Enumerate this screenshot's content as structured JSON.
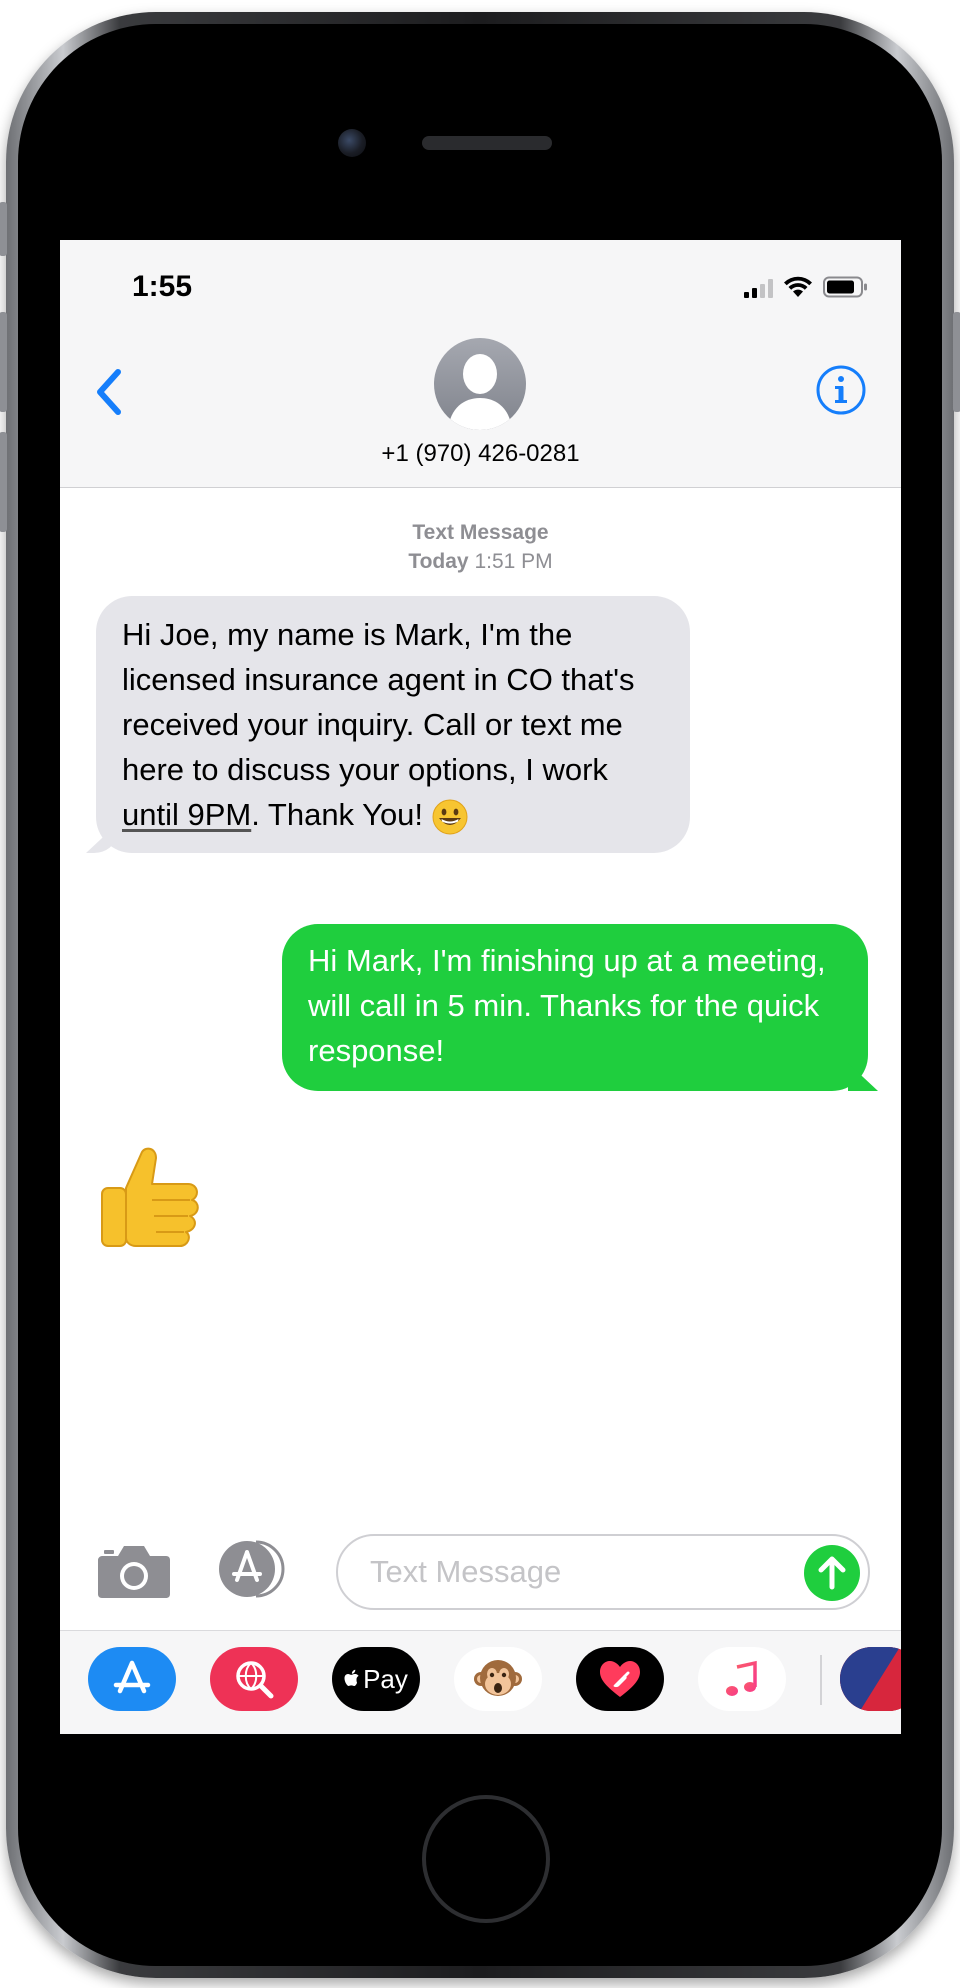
{
  "status_bar": {
    "time": "1:55",
    "icons": [
      "cellular-signal-icon",
      "wifi-icon",
      "battery-icon"
    ]
  },
  "header": {
    "back_icon": "chevron-left-icon",
    "avatar_icon": "person-silhouette-icon",
    "contact_number": "+1 (970) 426-0281",
    "info_icon": "info-icon"
  },
  "conversation": {
    "meta_title": "Text Message",
    "meta_day": "Today",
    "meta_time": "1:51 PM",
    "incoming": {
      "text_before_link": "Hi Joe, my name is Mark, I'm the licensed insurance agent in CO that's received your inquiry. Call or text me here to discuss your options, I work ",
      "link_text": "until 9PM",
      "text_after_link": ". Thank You!",
      "emoji": "grinning-face-emoji"
    },
    "outgoing": {
      "text": "Hi Mark, I'm finishing up at a meeting, will call in 5 min. Thanks for the quick response!"
    },
    "reaction_emoji": "thumbs-up-emoji"
  },
  "composer": {
    "camera_icon": "camera-icon",
    "apps_icon": "app-store-icon",
    "placeholder": "Text Message",
    "value": "",
    "send_icon": "arrow-up-icon"
  },
  "app_drawer": {
    "apps": [
      {
        "name": "App Store",
        "icon": "app-store-icon"
      },
      {
        "name": "Web Search",
        "icon": "globe-search-icon"
      },
      {
        "name": "Apple Pay",
        "icon": "apple-pay-icon",
        "label": "Pay"
      },
      {
        "name": "Animoji",
        "icon": "monkey-icon"
      },
      {
        "name": "Digital Touch",
        "icon": "heart-hand-icon"
      },
      {
        "name": "Music",
        "icon": "music-note-icon"
      },
      {
        "name": "More",
        "icon": "partial-app-icon"
      }
    ]
  },
  "colors": {
    "ios_blue": "#157efb",
    "imessage_green": "#1fce3e",
    "incoming_bubble": "#e5e5ea",
    "meta_gray": "#8e8e93"
  }
}
